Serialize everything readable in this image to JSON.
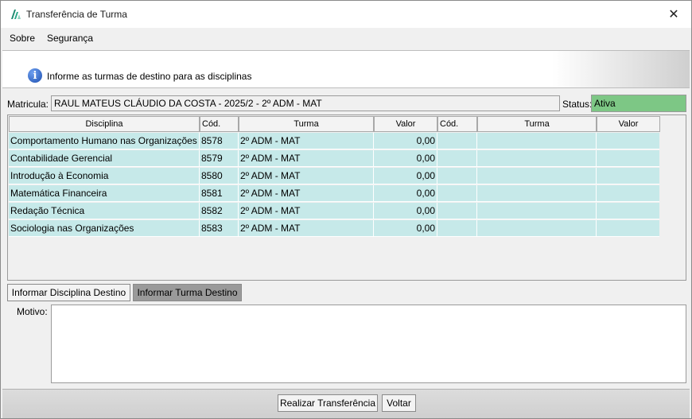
{
  "window": {
    "title": "Transferência de Turma"
  },
  "menu": {
    "sobre": "Sobre",
    "seguranca": "Segurança"
  },
  "banner": {
    "text": "Informe as turmas de destino para as disciplinas"
  },
  "matricula": {
    "label": "Matricula:",
    "value": "RAUL MATEUS CLÁUDIO DA COSTA - 2025/2 - 2º ADM - MAT"
  },
  "status": {
    "label": "Status:",
    "value": "Ativa",
    "color": "#7dc785"
  },
  "grid": {
    "headers": [
      "Disciplina",
      "Cód.",
      "Turma",
      "Valor",
      "Cód.",
      "Turma",
      "Valor"
    ],
    "rows": [
      {
        "disciplina": "Comportamento Humano nas Organizações",
        "cod": "8578",
        "turma": "2º ADM - MAT",
        "valor": "0,00",
        "cod2": "",
        "turma2": "",
        "valor2": ""
      },
      {
        "disciplina": "Contabilidade Gerencial",
        "cod": "8579",
        "turma": "2º ADM - MAT",
        "valor": "0,00",
        "cod2": "",
        "turma2": "",
        "valor2": ""
      },
      {
        "disciplina": "Introdução à Economia",
        "cod": "8580",
        "turma": "2º ADM - MAT",
        "valor": "0,00",
        "cod2": "",
        "turma2": "",
        "valor2": ""
      },
      {
        "disciplina": "Matemática Financeira",
        "cod": "8581",
        "turma": "2º ADM - MAT",
        "valor": "0,00",
        "cod2": "",
        "turma2": "",
        "valor2": ""
      },
      {
        "disciplina": "Redação Técnica",
        "cod": "8582",
        "turma": "2º ADM - MAT",
        "valor": "0,00",
        "cod2": "",
        "turma2": "",
        "valor2": ""
      },
      {
        "disciplina": "Sociologia nas Organizações",
        "cod": "8583",
        "turma": "2º ADM - MAT",
        "valor": "0,00",
        "cod2": "",
        "turma2": "",
        "valor2": ""
      }
    ],
    "row_color": "#c6e9e9"
  },
  "tabs": {
    "disciplina": "Informar Disciplina Destino",
    "turma": "Informar Turma Destino"
  },
  "motivo": {
    "label": "Motivo:",
    "value": ""
  },
  "footer": {
    "realizar": "Realizar Transferência",
    "voltar": "Voltar"
  },
  "icons": {
    "app": "app-logo-icon",
    "close": "close-icon",
    "info": "info-icon"
  }
}
